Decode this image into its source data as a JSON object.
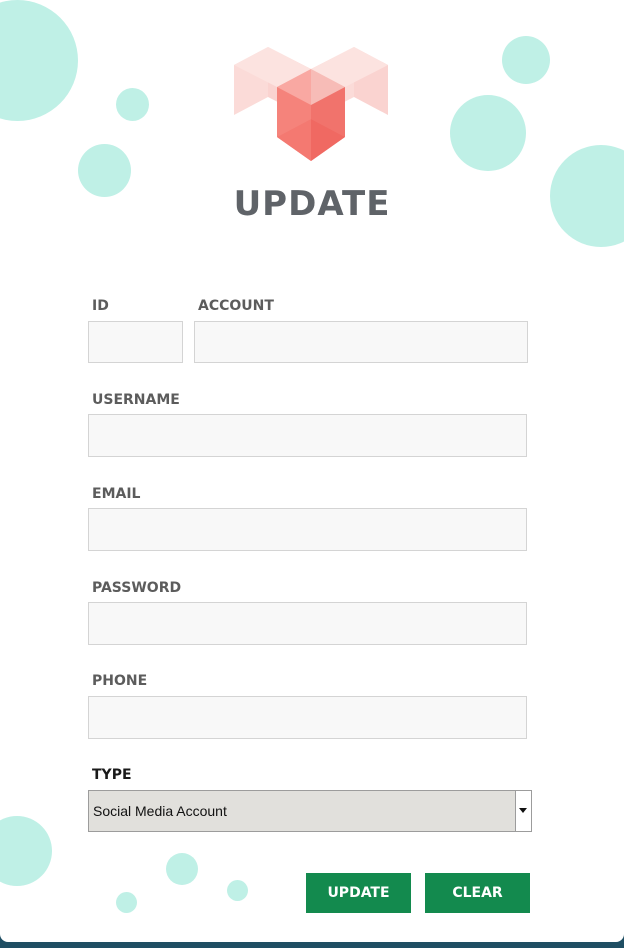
{
  "header": {
    "title": "UPDATE",
    "logo_icon": "hearts-cubes-logo"
  },
  "form": {
    "id": {
      "label": "ID",
      "value": ""
    },
    "account": {
      "label": "ACCOUNT",
      "value": ""
    },
    "username": {
      "label": "USERNAME",
      "value": ""
    },
    "email": {
      "label": "EMAIL",
      "value": ""
    },
    "password": {
      "label": "PASSWORD",
      "value": ""
    },
    "phone": {
      "label": "PHONE",
      "value": ""
    },
    "type": {
      "label": "TYPE",
      "selected": "Social Media Account"
    }
  },
  "actions": {
    "update_label": "UPDATE",
    "clear_label": "CLEAR"
  },
  "colors": {
    "accent": "#138a4e",
    "bubble": "#bff0e6",
    "logo_red": "#f0665f",
    "background": "#1f4e63"
  }
}
